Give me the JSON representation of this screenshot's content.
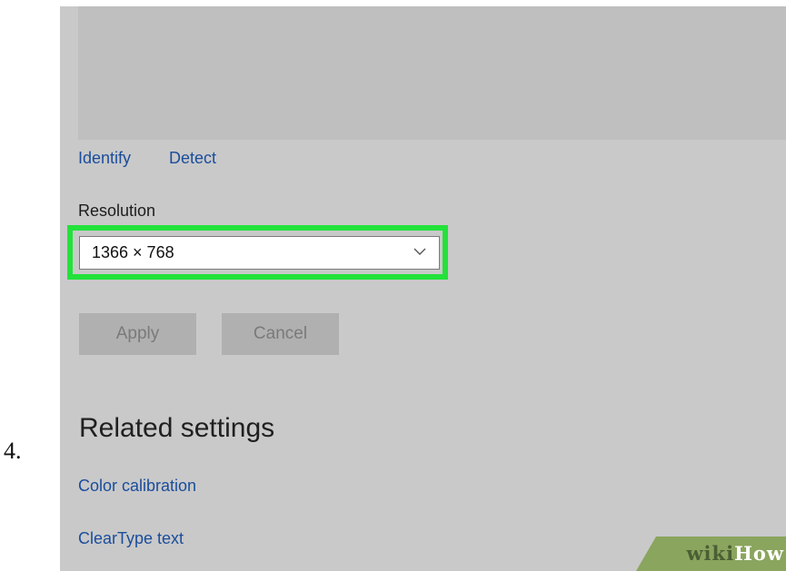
{
  "step": {
    "number": "4."
  },
  "display": {
    "identify_label": "Identify",
    "detect_label": "Detect"
  },
  "resolution": {
    "label": "Resolution",
    "selected_value": "1366 × 768"
  },
  "buttons": {
    "apply_label": "Apply",
    "cancel_label": "Cancel"
  },
  "related_settings": {
    "heading": "Related settings",
    "links": [
      "Color calibration",
      "ClearType text"
    ]
  },
  "watermark": {
    "part1": "wiki",
    "part2": "How"
  },
  "colors": {
    "highlight": "#22e23a",
    "link": "#1a4d9c",
    "background": "#c9c9c9"
  }
}
